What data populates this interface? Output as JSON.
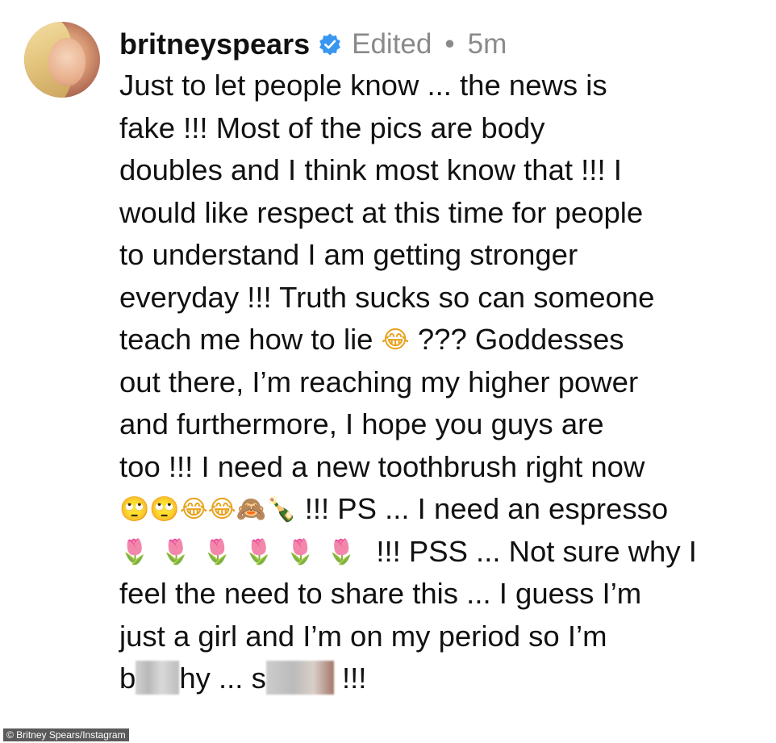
{
  "post": {
    "username": "britneyspears",
    "edited_label": "Edited",
    "separator": "•",
    "time_ago": "5m",
    "verified_icon": "verified-badge-icon",
    "caption_lines": {
      "l1": "Just to let people know ... the news is",
      "l2": "fake !!! Most of the pics are body",
      "l3": "doubles and I think most know that !!! I",
      "l4": "would like respect at this time for people",
      "l5": "to understand I am getting stronger",
      "l6": "everyday !!! Truth sucks so can someone",
      "l7a": "teach me how to lie",
      "l7b": "??? Goddesses",
      "l8": "out there, I’m reaching my higher power",
      "l9": "and furthermore, I hope you guys are",
      "l10": "too !!! I need a new toothbrush right now",
      "l11b": "!!! PS ... I need an espresso",
      "l12b": "!!! PSS ... Not sure why I",
      "l13": "feel the need to share this ... I guess I’m",
      "l14": "just a girl and I’m on my period so I’m",
      "l15a": "b",
      "l15b": "hy ... s",
      "l15c": "!!!"
    },
    "emojis": {
      "laugh_cry": "😂",
      "eye_roll": "🙄",
      "see_no_evil": "🙈",
      "champagne": "🍾",
      "tulip": "🌷"
    }
  },
  "credit": "© Britney Spears/Instagram",
  "colors": {
    "verified_blue": "#3897f0",
    "meta_gray": "#8a8a8a",
    "text": "#111111"
  }
}
